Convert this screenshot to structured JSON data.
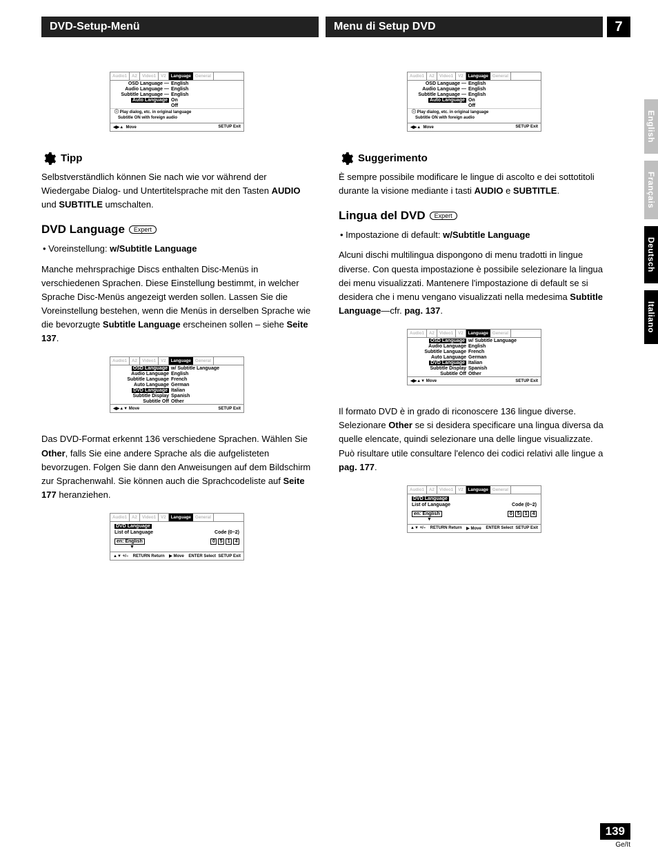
{
  "header": {
    "left": "DVD-Setup-Menü",
    "right": "Menu di Setup DVD",
    "chapter": "7"
  },
  "sideTabs": [
    "English",
    "Français",
    "Deutsch",
    "Italiano"
  ],
  "osd": {
    "tabs": [
      "Audio1",
      "A2",
      "Video1",
      "V2",
      "Language",
      "General"
    ],
    "box1_rows": [
      {
        "label": "OSD Language",
        "sep": "—",
        "val": "English"
      },
      {
        "label": "Audio Language",
        "sep": "—",
        "val": "English"
      },
      {
        "label": "Subtitle Language",
        "sep": "—",
        "val": "English"
      },
      {
        "label": "Auto Language",
        "sep": "",
        "val": "On",
        "sel": true
      },
      {
        "label": "",
        "sep": "",
        "val": "Off"
      }
    ],
    "info1": "Play dialog, etc. in original language",
    "info2": "Subtitle ON with foreign audio",
    "foot_move": "Move",
    "foot_setup": "SETUP",
    "foot_exit": "Exit",
    "box2_rows": [
      {
        "label": "OSD Language",
        "val": "w/ Subtitle Language",
        "sel": true
      },
      {
        "label": "Audio Language",
        "val": "English"
      },
      {
        "label": "Subtitle Language",
        "val": "French"
      },
      {
        "label": "Auto Language",
        "val": "German"
      },
      {
        "label": "DVD Language",
        "val": "Italian",
        "hl": true
      },
      {
        "label": "Subtitle Display",
        "val": "Spanish"
      },
      {
        "label": "Subtitle Off",
        "val": "Other"
      }
    ],
    "box3": {
      "title": "DVD Language",
      "list": "List of Language",
      "code_lbl": "Code (0~2)",
      "lang": "en: English",
      "codes": [
        "0",
        "5",
        "1",
        "4"
      ],
      "plus": "+/–",
      "enter": "ENTER",
      "select": "Select",
      "return": "RETURN",
      "ret2": "Return"
    }
  },
  "de": {
    "tip_title": "Tipp",
    "tip_body_a": "Selbstverständlich können Sie nach wie vor während der Wiedergabe Dialog- und Untertitelsprache mit den Tasten ",
    "tip_b1": "AUDIO",
    "tip_mid": " und ",
    "tip_b2": "SUBTITLE",
    "tip_end": " umschalten.",
    "h2": "DVD Language",
    "expert": "Expert",
    "bullet_a": "Voreinstellung: ",
    "bullet_b": "w/Subtitle Language",
    "p1a": "Manche mehrsprachige Discs enthalten Disc-Menüs in verschiedenen Sprachen. Diese Einstellung bestimmt, in welcher Sprache Disc-Menüs angezeigt werden sollen. Lassen Sie die Voreinstellung bestehen, wenn die Menüs in derselben Sprache wie die bevorzugte ",
    "p1b": "Subtitle Language",
    "p1c": " erscheinen sollen – siehe ",
    "p1d": "Seite 137",
    "p1e": ".",
    "p2a": "Das DVD-Format erkennt 136 verschiedene Sprachen. Wählen Sie ",
    "p2b": "Other",
    "p2c": ", falls Sie eine andere Sprache als die aufgelisteten bevorzugen. Folgen Sie dann den Anweisungen auf dem Bildschirm zur Sprachenwahl. Sie können auch die Sprachcodeliste auf ",
    "p2d": "Seite 177",
    "p2e": " heranziehen."
  },
  "it": {
    "tip_title": "Suggerimento",
    "tip_body_a": "È sempre possibile modificare le lingue di ascolto e dei sottotitoli durante la visione mediante i tasti ",
    "tip_b1": "AUDIO",
    "tip_mid": " e ",
    "tip_b2": "SUBTITLE",
    "tip_end": ".",
    "h2": "Lingua del DVD",
    "expert": "Expert",
    "bullet_a": "Impostazione di default: ",
    "bullet_b": "w/Subtitle Language",
    "p1a": "Alcuni dischi multilingua dispongono di menu tradotti in lingue diverse. Con questa impostazione è possibile selezionare la lingua dei menu visualizzati. Mantenere l'impostazione di default se si desidera che i menu vengano visualizzati nella medesima ",
    "p1b": "Subtitle Language",
    "p1c": "—cfr. ",
    "p1d": "pag. 137",
    "p1e": ".",
    "p2a": "Il formato DVD è in grado di riconoscere 136 lingue diverse. Selezionare ",
    "p2b": "Other",
    "p2c": " se si desidera specificare una lingua diversa da quelle elencate, quindi selezionare una delle lingue visualizzate. Può risultare utile consultare l'elenco dei codici relativi alle lingue a ",
    "p2d": "pag. 177",
    "p2e": "."
  },
  "pageNumber": "139",
  "pageSub": "Ge/It"
}
